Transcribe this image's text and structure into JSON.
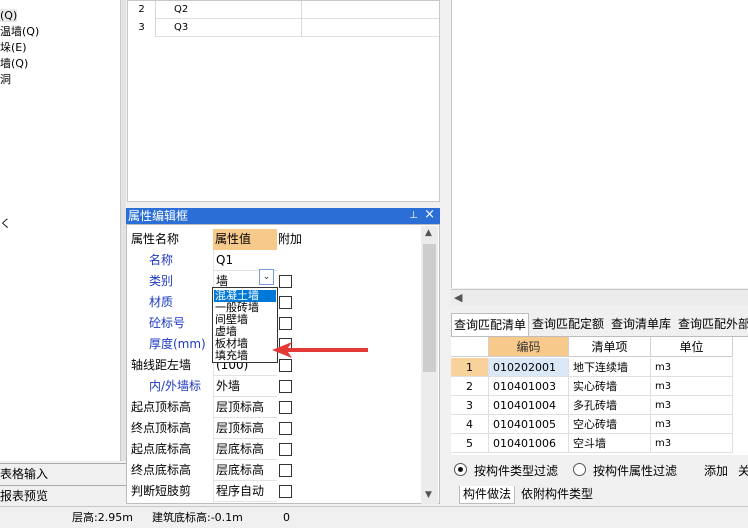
{
  "tree": {
    "items": [
      "(Q)",
      "温墙(Q)",
      "垛(E)",
      "墙(Q)",
      "洞",
      "く"
    ]
  },
  "left_tabs": [
    "表格输入",
    "报表预览"
  ],
  "top_table": {
    "rows": [
      {
        "num": "2",
        "name": "Q2"
      },
      {
        "num": "3",
        "name": "Q3"
      }
    ]
  },
  "property_panel": {
    "title": "属性编辑框",
    "pin_icon": "pin-icon",
    "close_label": "×",
    "headers": {
      "name": "属性名称",
      "value": "属性值",
      "extra": "附加"
    },
    "rows": [
      {
        "label": "名称",
        "value": "Q1",
        "blue": true,
        "check": false
      },
      {
        "label": "类别",
        "value": "墙",
        "blue": true,
        "check": true
      },
      {
        "label": "材质",
        "value": "",
        "blue": true,
        "check": true
      },
      {
        "label": "砼标号",
        "value": "",
        "blue": true,
        "check": true
      },
      {
        "label": "厚度(mm)",
        "value": "",
        "blue": true,
        "check": true
      },
      {
        "label": "轴线距左墙",
        "value": "(100)",
        "blue": false,
        "check": true
      },
      {
        "label": "内/外墙标",
        "value": "外墙",
        "blue": true,
        "check": true
      },
      {
        "label": "起点顶标高",
        "value": "层顶标高",
        "blue": false,
        "check": true
      },
      {
        "label": "终点顶标高",
        "value": "层顶标高",
        "blue": false,
        "check": true
      },
      {
        "label": "起点底标高",
        "value": "层底标高",
        "blue": false,
        "check": true
      },
      {
        "label": "终点底标高",
        "value": "层底标高",
        "blue": false,
        "check": true
      },
      {
        "label": "判断短肢剪",
        "value": "程序自动",
        "blue": false,
        "check": true
      }
    ]
  },
  "dropdown": {
    "options": [
      "混凝土墙",
      "一般砖墙",
      "间壁墙",
      "虚墙",
      "板材墙",
      "填充墙"
    ],
    "selected_index": 0
  },
  "right_tabs": [
    "查询匹配清单",
    "查询匹配定额",
    "查询清单库",
    "查询匹配外部"
  ],
  "grid": {
    "headers": [
      "编码",
      "清单项",
      "单位"
    ],
    "rows": [
      {
        "num": "1",
        "code": "010202001",
        "item": "地下连续墙",
        "unit": "m3"
      },
      {
        "num": "2",
        "code": "010401003",
        "item": "实心砖墙",
        "unit": "m3"
      },
      {
        "num": "3",
        "code": "010401004",
        "item": "多孔砖墙",
        "unit": "m3"
      },
      {
        "num": "4",
        "code": "010401005",
        "item": "空心砖墙",
        "unit": "m3"
      },
      {
        "num": "5",
        "code": "010401006",
        "item": "空斗墙",
        "unit": "m3"
      }
    ]
  },
  "filters": {
    "by_type": "按构件类型过滤",
    "by_attr": "按构件属性过滤",
    "add": "添加",
    "close": "关"
  },
  "bottom_tabs": [
    "构件做法",
    "依附构件类型"
  ],
  "status": {
    "floor_height": "层高:2.95m",
    "base_elev": "建筑底标高:-0.1m",
    "extra": "0"
  }
}
